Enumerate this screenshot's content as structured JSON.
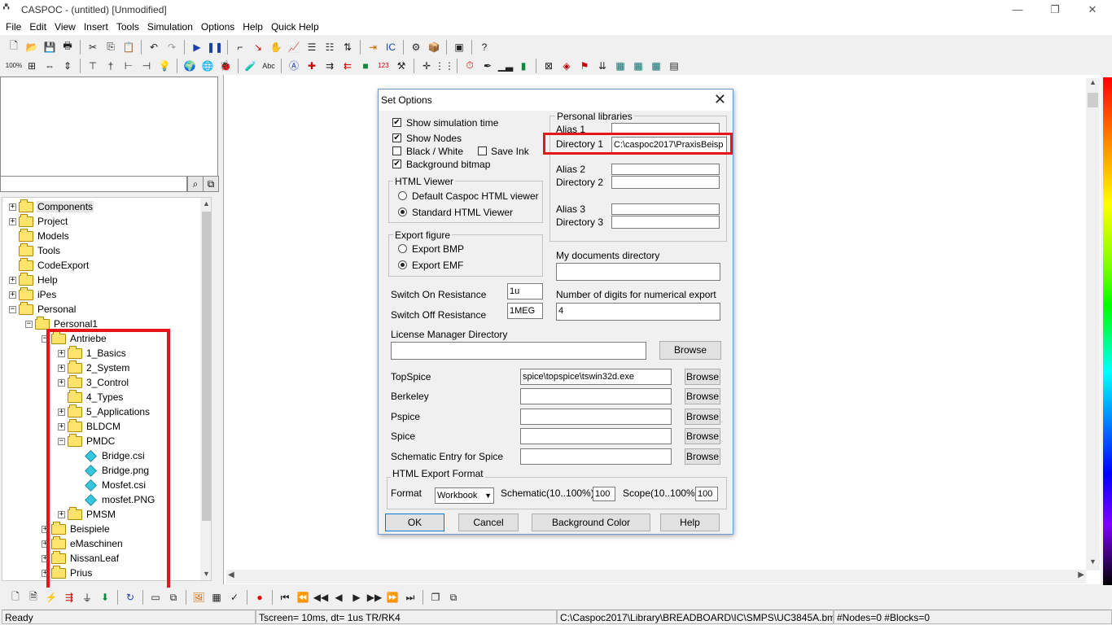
{
  "window": {
    "title": "CASPOC - (untitled) [Unmodified]",
    "app_icon_text": "CASPOC"
  },
  "menu": [
    "File",
    "Edit",
    "View",
    "Insert",
    "Tools",
    "Simulation",
    "Options",
    "Help",
    "Quick Help"
  ],
  "tree": {
    "items": [
      {
        "label": "Components",
        "expander": "+",
        "selected": true
      },
      {
        "label": "Project",
        "expander": "+"
      },
      {
        "label": "Models",
        "expander": ""
      },
      {
        "label": "Tools",
        "expander": ""
      },
      {
        "label": "CodeExport",
        "expander": ""
      },
      {
        "label": "Help",
        "expander": "+"
      },
      {
        "label": "iPes",
        "expander": "+"
      },
      {
        "label": "Personal",
        "expander": "−"
      },
      {
        "label": "Personal1",
        "expander": "−"
      },
      {
        "label": "Antriebe",
        "expander": "−"
      },
      {
        "label": "1_Basics",
        "expander": "+"
      },
      {
        "label": "2_System",
        "expander": "+"
      },
      {
        "label": "3_Control",
        "expander": "+"
      },
      {
        "label": "4_Types",
        "expander": ""
      },
      {
        "label": "5_Applications",
        "expander": "+"
      },
      {
        "label": "BLDCM",
        "expander": "+"
      },
      {
        "label": "PMDC",
        "expander": "−"
      },
      {
        "label": "Bridge.csi",
        "expander": "",
        "file": true
      },
      {
        "label": "Bridge.png",
        "expander": "",
        "file": true
      },
      {
        "label": "Mosfet.csi",
        "expander": "",
        "file": true
      },
      {
        "label": "mosfet.PNG",
        "expander": "",
        "file": true
      },
      {
        "label": "PMSM",
        "expander": "+"
      },
      {
        "label": "Beispiele",
        "expander": "+"
      },
      {
        "label": "eMaschinen",
        "expander": "+"
      },
      {
        "label": "NissanLeaf",
        "expander": "+"
      },
      {
        "label": "Prius",
        "expander": "+"
      }
    ]
  },
  "status": {
    "ready": "Ready",
    "tscreen": "Tscreen= 10ms, dt= 1us TR/RK4",
    "path": "C:\\Caspoc2017\\Library\\BREADBOARD\\IC\\SMPS\\UC3845A.bmp",
    "counts": "#Nodes=0 #Blocks=0"
  },
  "dialog": {
    "title": "Set Options",
    "checkboxes": {
      "show_sim_time": {
        "label": "Show simulation time",
        "checked": true
      },
      "show_nodes": {
        "label": "Show Nodes",
        "checked": true
      },
      "black_white": {
        "label": "Black / White",
        "checked": false
      },
      "save_ink": {
        "label": "Save Ink",
        "checked": false
      },
      "background_bitmap": {
        "label": "Background bitmap",
        "checked": true
      }
    },
    "html_viewer": {
      "title": "HTML Viewer",
      "options": [
        "Default Caspoc HTML viewer",
        "Standard HTML Viewer"
      ],
      "selected": 1
    },
    "export_figure": {
      "title": "Export figure",
      "options": [
        "Export BMP",
        "Export EMF"
      ],
      "selected": 1
    },
    "switch_on": {
      "label": "Switch On Resistance",
      "value": "1u"
    },
    "switch_off": {
      "label": "Switch Off Resistance",
      "value": "1MEG"
    },
    "personal_libraries": {
      "title": "Personal libraries",
      "alias1_label": "Alias 1",
      "alias1": "",
      "dir1_label": "Directory 1",
      "dir1": "C:\\caspoc2017\\PraxisBeisp",
      "alias2_label": "Alias 2",
      "alias2": "",
      "dir2_label": "Directory 2",
      "dir2": "",
      "alias3_label": "Alias 3",
      "alias3": "",
      "dir3_label": "Directory 3",
      "dir3": ""
    },
    "my_documents": {
      "label": "My documents directory",
      "value": ""
    },
    "digits": {
      "label": "Number of digits for numerical export",
      "value": "4"
    },
    "license": {
      "label": "License Manager Directory",
      "value": "",
      "browse": "Browse"
    },
    "spice_rows": [
      {
        "label": "TopSpice",
        "value": "spice\\topspice\\tswin32d.exe",
        "browse": "Browse"
      },
      {
        "label": "Berkeley",
        "value": "",
        "browse": "Browse"
      },
      {
        "label": "Pspice",
        "value": "",
        "browse": "Browse"
      },
      {
        "label": "Spice",
        "value": "",
        "browse": "Browse"
      },
      {
        "label": "Schematic Entry for Spice",
        "value": "",
        "browse": "Browse"
      }
    ],
    "html_export": {
      "title": "HTML Export Format",
      "format_label": "Format",
      "format_value": "Workbook",
      "schematic_label": "Schematic(10..100%)",
      "schematic_value": "100",
      "scope_label": "Scope(10..100%)",
      "scope_value": "100"
    },
    "buttons": {
      "ok": "OK",
      "cancel": "Cancel",
      "bgcolor": "Background Color",
      "help": "Help"
    }
  },
  "colors": {
    "highlight_red": "#e8141c",
    "dialog_border": "#6c9bd2"
  }
}
